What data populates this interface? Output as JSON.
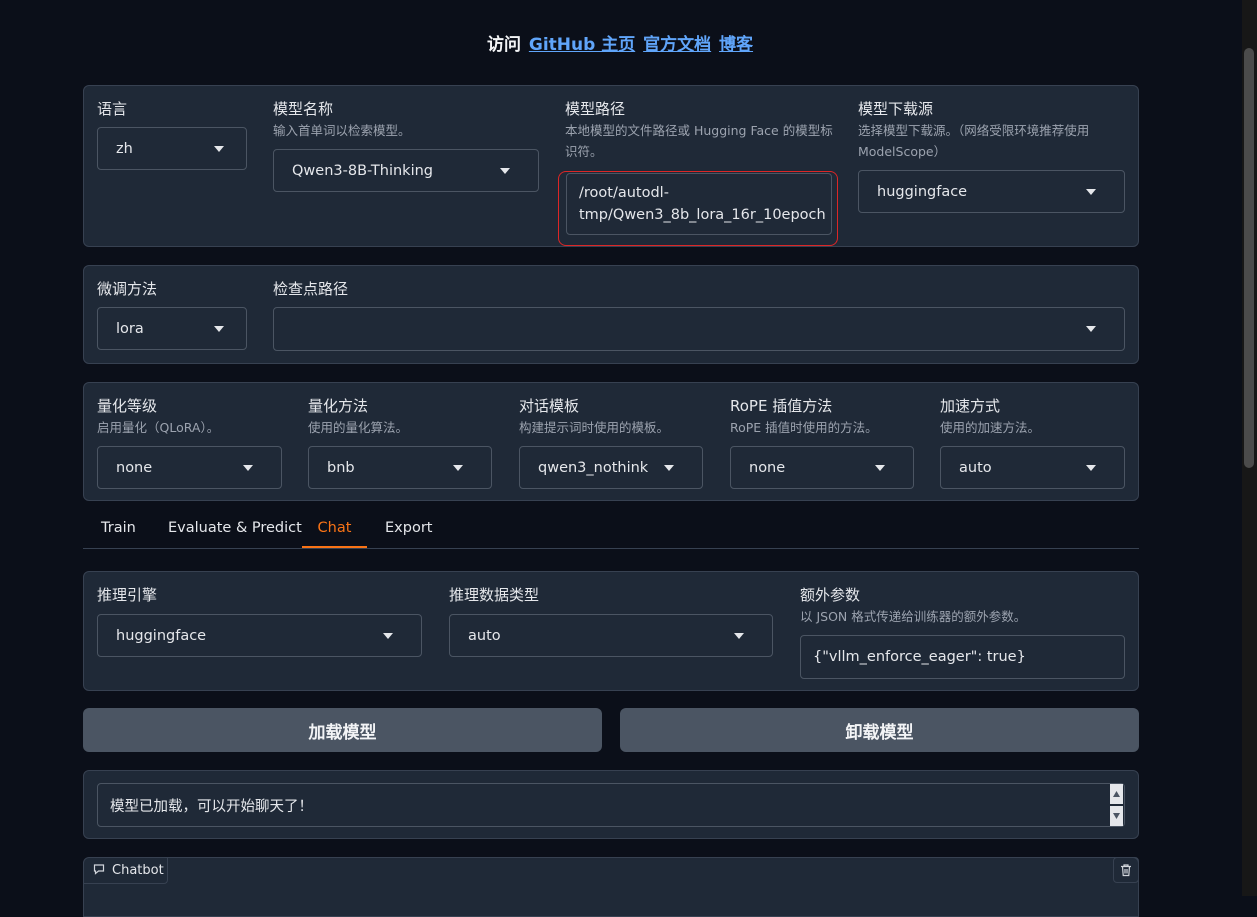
{
  "header": {
    "prefix": "访问",
    "links": [
      "GitHub 主页",
      "官方文档",
      "博客"
    ]
  },
  "top_panel": {
    "lang": {
      "label": "语言",
      "value": "zh"
    },
    "model_name": {
      "label": "模型名称",
      "description": "输入首单词以检索模型。",
      "value": "Qwen3-8B-Thinking"
    },
    "model_path": {
      "label": "模型路径",
      "description": "本地模型的文件路径或 Hugging Face 的模型标识符。",
      "value_line1": "/root/autodl-",
      "value_line2": "tmp/Qwen3_8b_lora_16r_10epoch"
    },
    "hub": {
      "label": "模型下载源",
      "description": "选择模型下载源。（网络受限环境推荐使用 ModelScope）",
      "value": "huggingface"
    }
  },
  "finetune_panel": {
    "method": {
      "label": "微调方法",
      "value": "lora"
    },
    "checkpoint": {
      "label": "检查点路径",
      "value": ""
    }
  },
  "quant_panel": {
    "quant_bit": {
      "label": "量化等级",
      "description": "启用量化（QLoRA）。",
      "value": "none"
    },
    "quant_method": {
      "label": "量化方法",
      "description": "使用的量化算法。",
      "value": "bnb"
    },
    "template": {
      "label": "对话模板",
      "description": "构建提示词时使用的模板。",
      "value": "qwen3_nothink"
    },
    "rope": {
      "label": "RoPE 插值方法",
      "description": "RoPE 插值时使用的方法。",
      "value": "none"
    },
    "booster": {
      "label": "加速方式",
      "description": "使用的加速方法。",
      "value": "auto"
    }
  },
  "tabs": [
    "Train",
    "Evaluate & Predict",
    "Chat",
    "Export"
  ],
  "active_tab": "Chat",
  "chat_panel": {
    "infer_backend": {
      "label": "推理引擎",
      "value": "huggingface"
    },
    "infer_dtype": {
      "label": "推理数据类型",
      "value": "auto"
    },
    "extra_args": {
      "label": "额外参数",
      "description": "以 JSON 格式传递给训练器的额外参数。",
      "value": "{\"vllm_enforce_eager\": true}"
    }
  },
  "buttons": {
    "load": "加载模型",
    "unload": "卸载模型"
  },
  "info_box": "模型已加载，可以开始聊天了！",
  "chatbot": {
    "label": "Chatbot",
    "icon": "chat-icon",
    "clear_icon": "trash-icon"
  },
  "colors": {
    "accent": "#f97316",
    "link": "#60a5fa",
    "highlight_border": "#dc2626",
    "background": "#0b0f19",
    "panel": "#1f2937"
  }
}
